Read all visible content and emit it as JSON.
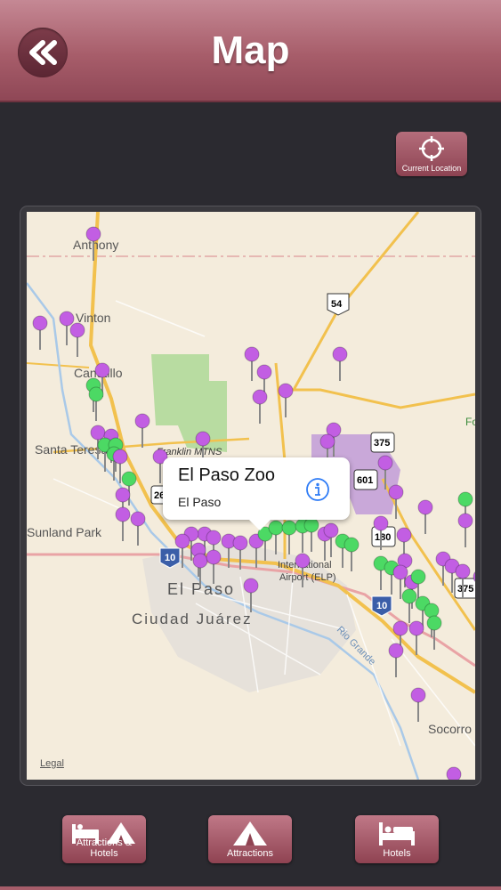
{
  "header": {
    "title": "Map"
  },
  "current_location": {
    "label": "Current Location"
  },
  "map": {
    "place_labels": [
      "Anthony",
      "Vinton",
      "Canutillo",
      "Santa Teresa",
      "Sunland Park",
      "El Paso",
      "Ciudad Juárez",
      "Franklin MTNS",
      "International Airport (ELP)",
      "Socorro",
      "Rio Grande",
      "Fo"
    ],
    "shields": [
      "54",
      "375",
      "601",
      "180",
      "10",
      "10",
      "26",
      "375"
    ],
    "legal": "Legal"
  },
  "callout": {
    "title": "El Paso Zoo",
    "subtitle": "El Paso"
  },
  "toolbar": {
    "attractions_hotels": "Attractions & Hotels",
    "attractions": "Attractions",
    "hotels": "Hotels"
  },
  "colors": {
    "accent": "#a75d6a",
    "pin_purple": "#c25ee3",
    "pin_green": "#4cd964"
  }
}
